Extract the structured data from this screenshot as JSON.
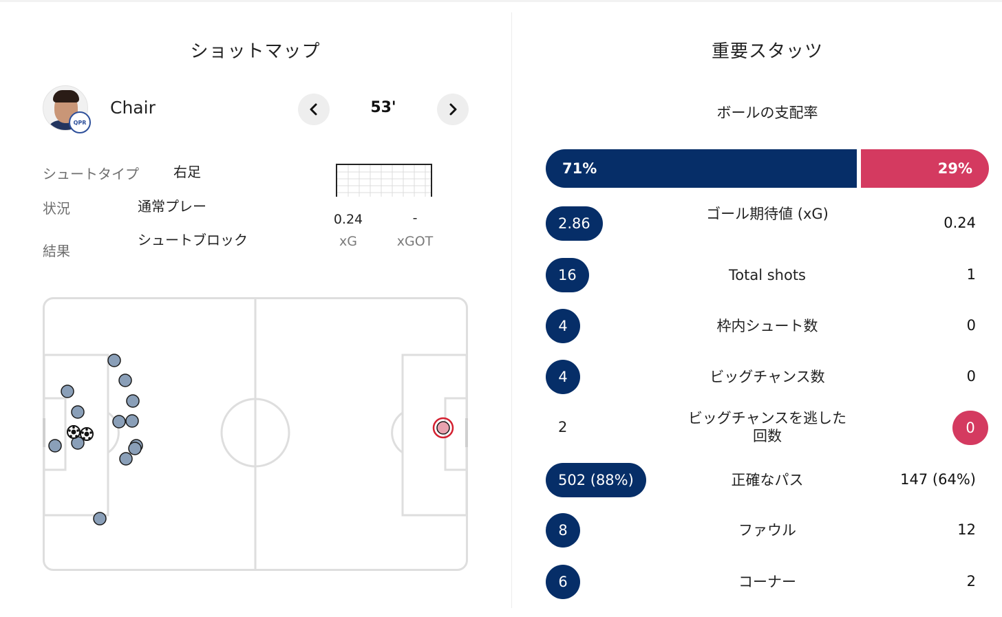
{
  "shotmap": {
    "title": "ショットマップ",
    "player_name": "Chair",
    "minute": "53'",
    "prev_icon": "chevron-left-icon",
    "next_icon": "chevron-right-icon",
    "details": [
      {
        "label": "シュートタイプ",
        "value": "右足"
      },
      {
        "label": "状況",
        "value": "通常プレー"
      },
      {
        "label": "結果",
        "value": "シュートブロック"
      }
    ],
    "xg": {
      "value": "0.24",
      "label": "xG"
    },
    "xgot": {
      "value": "-",
      "label": "xGOT"
    },
    "colors": {
      "home_shot": "#8a9fb8",
      "selected_shot": "#e8a2ae",
      "selected_ring": "#d42030"
    }
  },
  "stats": {
    "title": "重要スタッツ",
    "possession": {
      "title": "ボールの支配率",
      "home": "71%",
      "away": "29%",
      "home_color": "#062e68",
      "away_color": "#d43a60"
    },
    "rows": [
      {
        "name": "ゴール期待値 (xG)",
        "home": "2.86",
        "away": "0.24",
        "highlight": "home"
      },
      {
        "name": "Total shots",
        "home": "16",
        "away": "1",
        "highlight": "home"
      },
      {
        "name": "枠内シュート数",
        "home": "4",
        "away": "0",
        "highlight": "home"
      },
      {
        "name": "ビッグチャンス数",
        "home": "4",
        "away": "0",
        "highlight": "home"
      },
      {
        "name": "ビッグチャンスを逃した回数",
        "home": "2",
        "away": "0",
        "highlight": "away"
      },
      {
        "name": "正確なパス",
        "home": "502 (88%)",
        "away": "147 (64%)",
        "highlight": "home"
      },
      {
        "name": "ファウル",
        "home": "8",
        "away": "12",
        "highlight": "home"
      },
      {
        "name": "コーナー",
        "home": "6",
        "away": "2",
        "highlight": "home"
      }
    ]
  }
}
